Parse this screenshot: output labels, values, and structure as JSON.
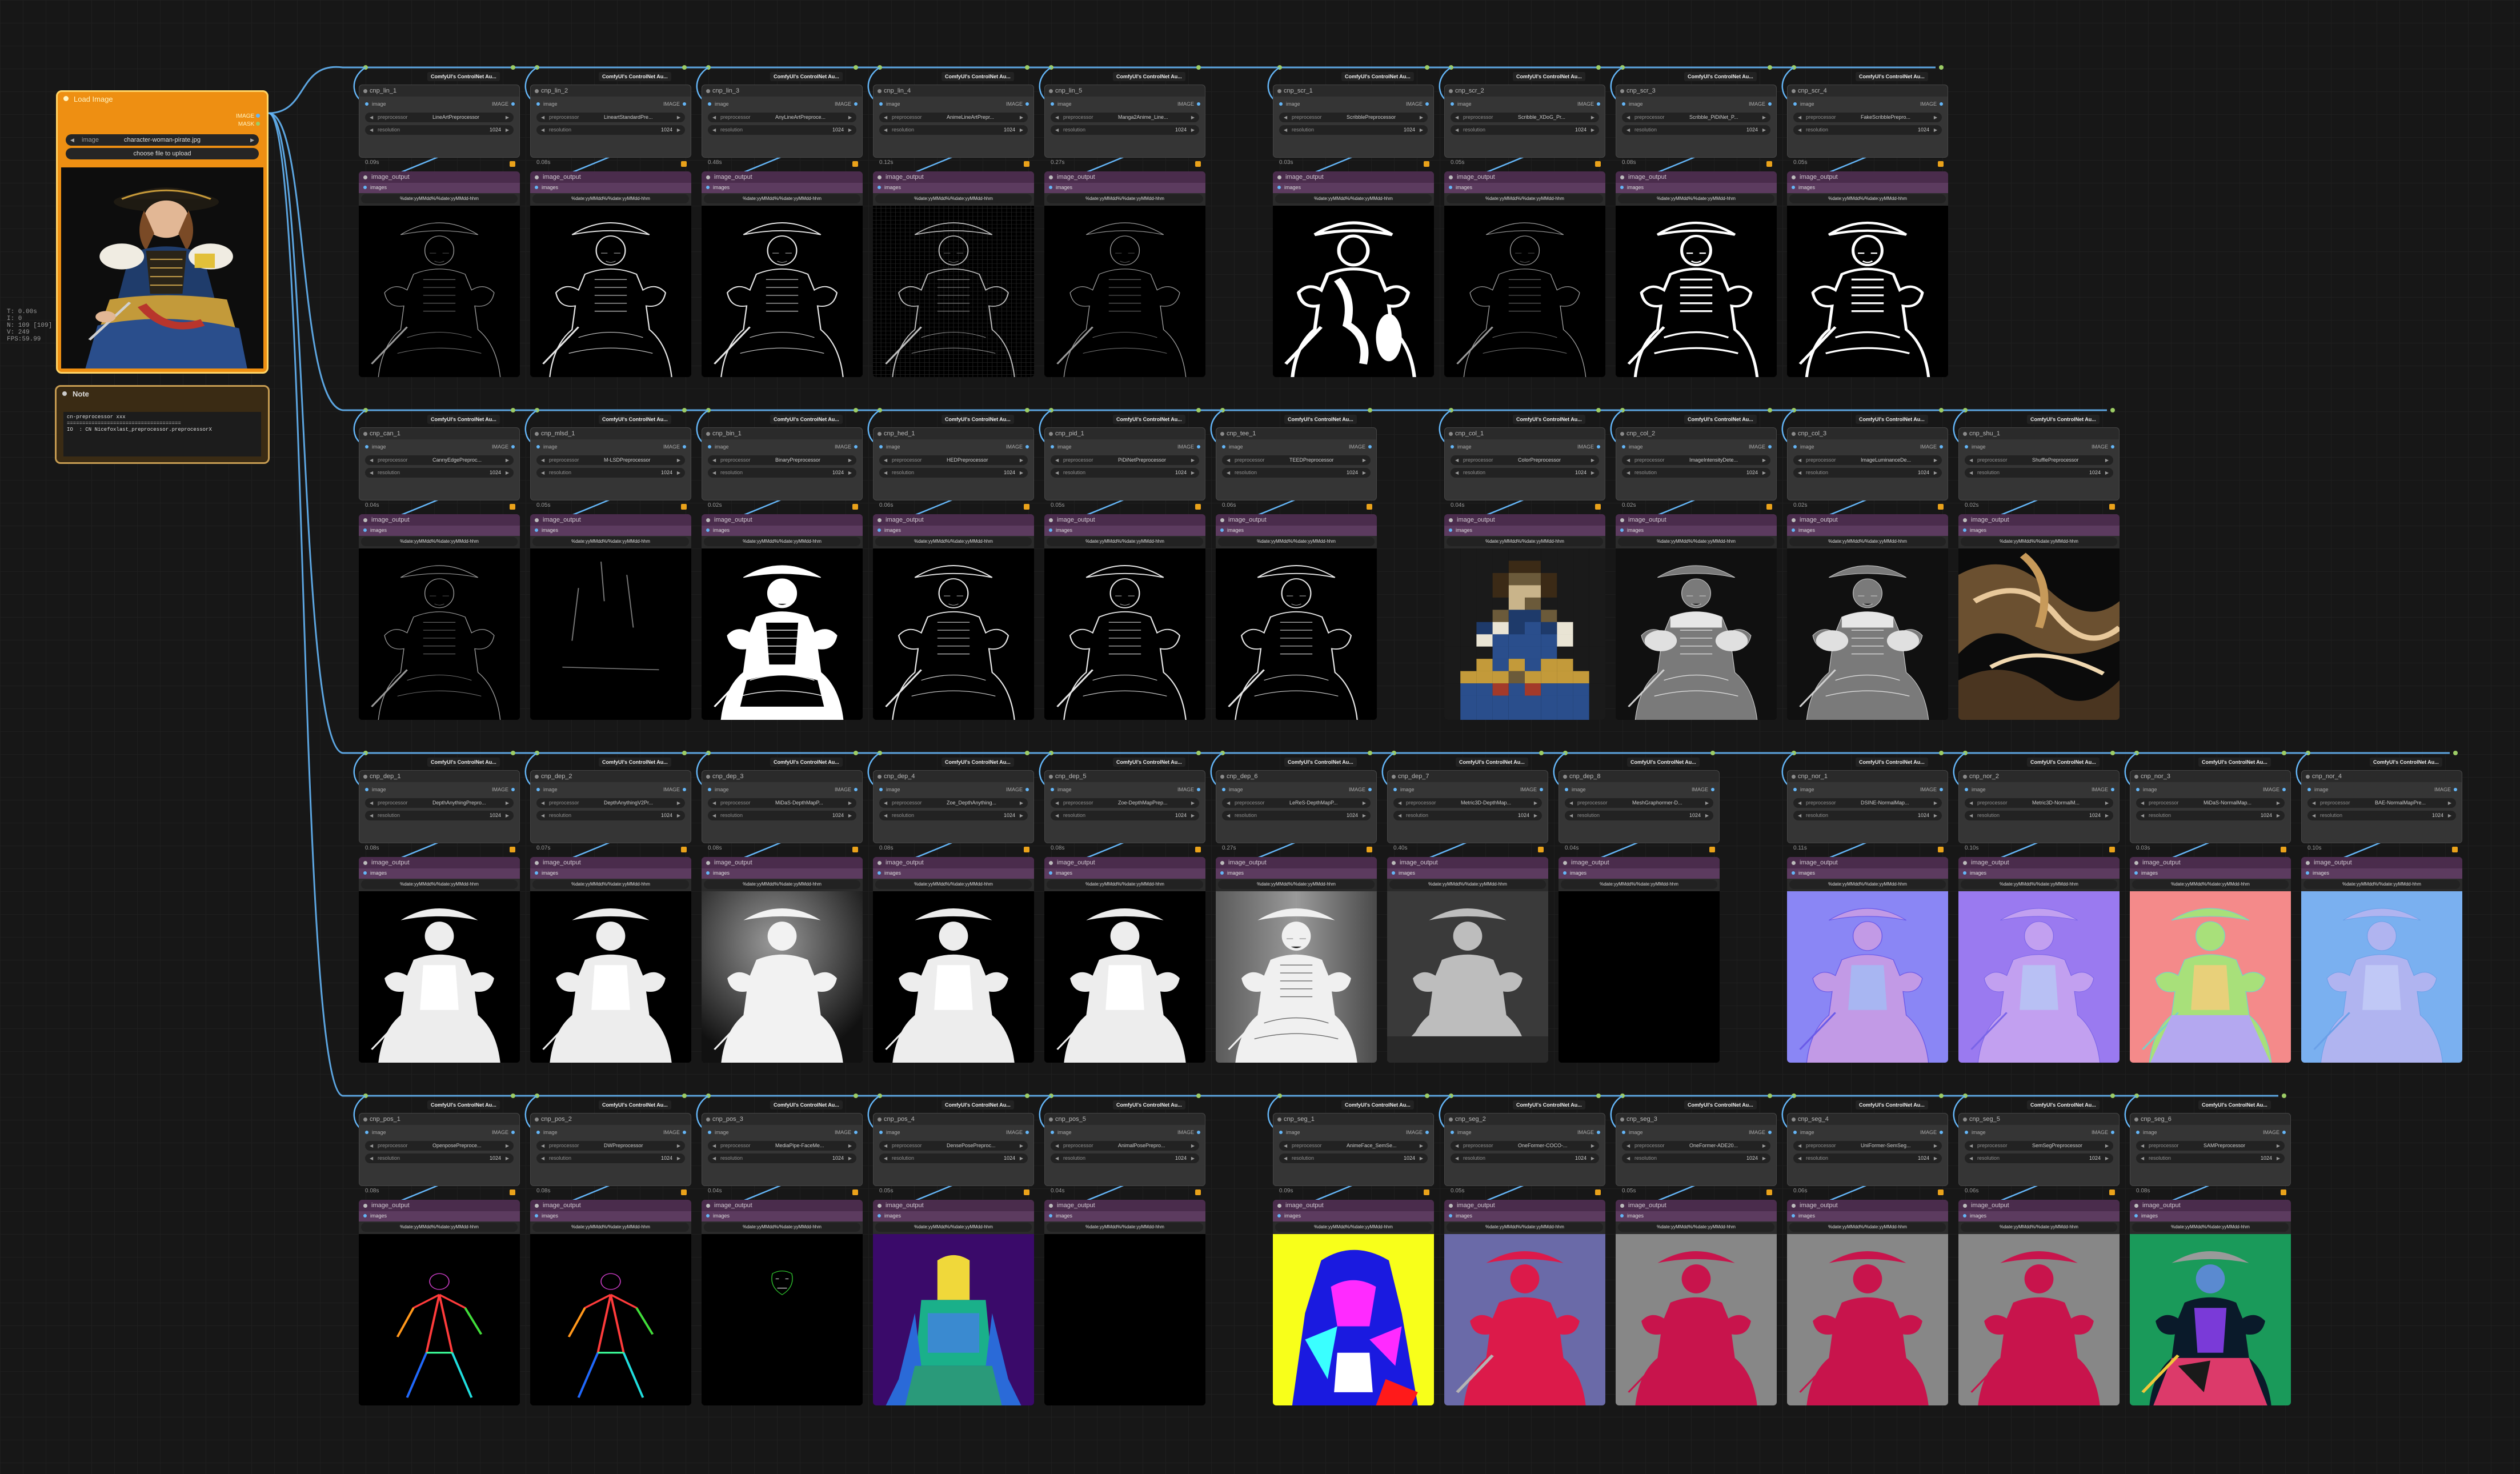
{
  "canvas_stats": [
    "T: 0.00s",
    "I: 0",
    "N: 109 [109]",
    "V: 249",
    "FPS:59.99"
  ],
  "load_node": {
    "title": "Load Image",
    "outputs": [
      "IMAGE",
      "MASK"
    ],
    "image_label": "image",
    "image_value": "character-woman-pirate.jpg",
    "upload_label": "choose file to upload"
  },
  "note": {
    "title": "Note",
    "text": "cn-preprocessor xxx\n=====================================\nIO  : CN Nicefoxlast_preprocessor.preprocessorX"
  },
  "node_common": {
    "pack_tag": "ComfyUI's ControlNet Au...",
    "input_label": "image",
    "output_label": "IMAGE",
    "param_preprocessor": "preprocessor",
    "param_resolution": "resolution",
    "resolution_value": "1024",
    "out_title": "image_output",
    "out_slot": "images",
    "out_filename": "%date:yyMMdd%/%date:yyMMdd-hhm"
  },
  "rows": [
    {
      "nodes": [
        {
          "title": "cnp_lin_1",
          "pre": "LineArtPreprocessor",
          "time": "0.09s",
          "style": "lin_thin"
        },
        {
          "title": "cnp_lin_2",
          "pre": "LineartStandardPre...",
          "time": "0.08s",
          "style": "lin"
        },
        {
          "title": "cnp_lin_3",
          "pre": "AnyLineArtPreproce...",
          "time": "0.48s",
          "style": "lin"
        },
        {
          "title": "cnp_lin_4",
          "pre": "AnimeLineArtPrepr...",
          "time": "0.12s",
          "style": "lin_grid"
        },
        {
          "title": "cnp_lin_5",
          "pre": "Manga2Anime_Line...",
          "time": "0.27s",
          "style": "lin_thin"
        },
        {
          "title": "cnp_scr_1",
          "pre": "ScribblePreprocessor",
          "time": "0.03s",
          "style": "scr_blob"
        },
        {
          "title": "cnp_scr_2",
          "pre": "Scribble_XDoG_Pr...",
          "time": "0.05s",
          "style": "lin_thin"
        },
        {
          "title": "cnp_scr_3",
          "pre": "Scribble_PiDiNet_P...",
          "time": "0.08s",
          "style": "scr_thick"
        },
        {
          "title": "cnp_scr_4",
          "pre": "FakeScribblePrepro...",
          "time": "0.05s",
          "style": "scr_thick"
        }
      ]
    },
    {
      "nodes": [
        {
          "title": "cnp_can_1",
          "pre": "CannyEdgePreproc...",
          "time": "0.04s",
          "style": "lin_thin"
        },
        {
          "title": "cnp_mlsd_1",
          "pre": "M-LSDPreprocessor",
          "time": "0.05s",
          "style": "mlsd"
        },
        {
          "title": "cnp_bin_1",
          "pre": "BinaryPreprocessor",
          "time": "0.02s",
          "style": "binary"
        },
        {
          "title": "cnp_hed_1",
          "pre": "HEDPreprocessor",
          "time": "0.06s",
          "style": "lin"
        },
        {
          "title": "cnp_pid_1",
          "pre": "PiDiNetPreprocessor",
          "time": "0.05s",
          "style": "lin"
        },
        {
          "title": "cnp_tee_1",
          "pre": "TEEDPreprocessor",
          "time": "0.06s",
          "style": "lin"
        },
        {
          "title": "cnp_col_1",
          "pre": "ColorPreprocessor",
          "time": "0.04s",
          "style": "color"
        },
        {
          "title": "cnp_col_2",
          "pre": "ImageIntensityDete...",
          "time": "0.02s",
          "style": "gray"
        },
        {
          "title": "cnp_col_3",
          "pre": "ImageLuminanceDe...",
          "time": "0.02s",
          "style": "gray"
        },
        {
          "title": "cnp_shu_1",
          "pre": "ShufflePreprocessor",
          "time": "0.02s",
          "style": "shuffle"
        }
      ]
    },
    {
      "nodes": [
        {
          "title": "cnp_dep_1",
          "pre": "DepthAnythingPrepro...",
          "time": "0.08s",
          "style": "depth"
        },
        {
          "title": "cnp_dep_2",
          "pre": "DepthAnythingV2Pr...",
          "time": "0.07s",
          "style": "depth"
        },
        {
          "title": "cnp_dep_3",
          "pre": "MiDaS-DepthMapP...",
          "time": "0.08s",
          "style": "depth_blur"
        },
        {
          "title": "cnp_dep_4",
          "pre": "Zoe_DepthAnything...",
          "time": "0.08s",
          "style": "depth"
        },
        {
          "title": "cnp_dep_5",
          "pre": "Zoe-DepthMapPrep...",
          "time": "0.08s",
          "style": "depth"
        },
        {
          "title": "cnp_dep_6",
          "pre": "LeReS-DepthMapP...",
          "time": "0.27s",
          "style": "depth_full"
        },
        {
          "title": "cnp_dep_7",
          "pre": "Metric3D-DepthMap...",
          "time": "0.40s",
          "style": "depth_soft"
        },
        {
          "title": "cnp_dep_8",
          "pre": "MeshGraphormer-D...",
          "time": "0.04s",
          "style": "black"
        },
        {
          "title": "cnp_nor_1",
          "pre": "DSINE-NormalMap...",
          "time": "0.11s",
          "style": "normal_a"
        },
        {
          "title": "cnp_nor_2",
          "pre": "Metric3D-NormalM...",
          "time": "0.10s",
          "style": "normal_b"
        },
        {
          "title": "cnp_nor_3",
          "pre": "MiDaS-NormalMap...",
          "time": "0.03s",
          "style": "normal_c"
        },
        {
          "title": "cnp_nor_4",
          "pre": "BAE-NormalMapPre...",
          "time": "0.10s",
          "style": "normal_d"
        }
      ]
    },
    {
      "nodes": [
        {
          "title": "cnp_pos_1",
          "pre": "OpenposePreproce...",
          "time": "0.08s",
          "style": "pose"
        },
        {
          "title": "cnp_pos_2",
          "pre": "DWPreprocessor",
          "time": "0.08s",
          "style": "pose"
        },
        {
          "title": "cnp_pos_3",
          "pre": "MediaPipe-FaceMe...",
          "time": "0.04s",
          "style": "face"
        },
        {
          "title": "cnp_pos_4",
          "pre": "DensePosePreproc...",
          "time": "0.05s",
          "style": "dense"
        },
        {
          "title": "cnp_pos_5",
          "pre": "AnimalPosePrepro...",
          "time": "0.04s",
          "style": "black"
        },
        {
          "title": "cnp_seg_1",
          "pre": "AnimeFace_SemSe...",
          "time": "0.09s",
          "style": "seg_anime"
        },
        {
          "title": "cnp_seg_2",
          "pre": "OneFormer-COCO-...",
          "time": "0.05s",
          "style": "seg_coco"
        },
        {
          "title": "cnp_seg_3",
          "pre": "OneFormer-ADE20...",
          "time": "0.05s",
          "style": "seg_ade"
        },
        {
          "title": "cnp_seg_4",
          "pre": "UniFormer-SemSeg...",
          "time": "0.06s",
          "style": "seg_ade"
        },
        {
          "title": "cnp_seg_5",
          "pre": "SemSegPreprocessor",
          "time": "0.06s",
          "style": "seg_ade"
        },
        {
          "title": "cnp_seg_6",
          "pre": "SAMPreprocessor",
          "time": "0.08s",
          "style": "sam"
        }
      ]
    }
  ]
}
